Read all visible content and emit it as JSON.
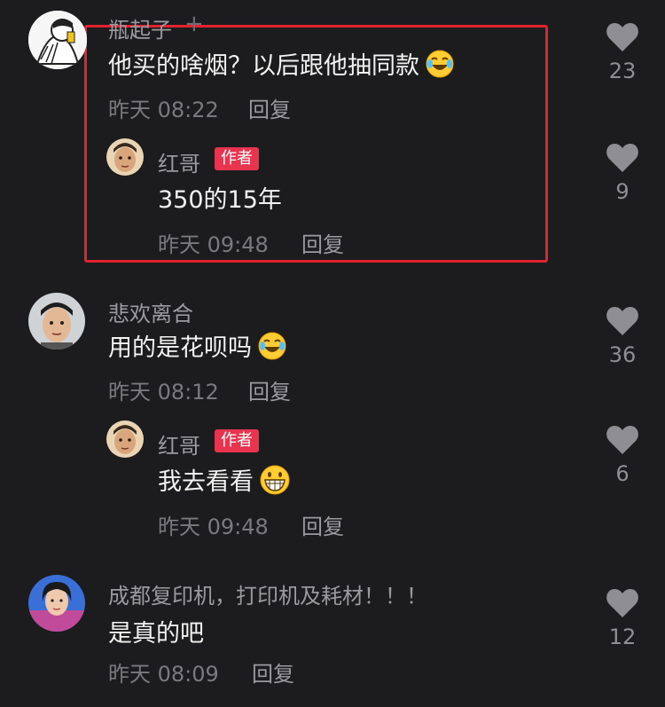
{
  "comments": [
    {
      "user": "瓶起子",
      "text": "他买的啥烟？以后跟他抽同款",
      "emoji": "laughing-crying-emoji",
      "time": "昨天 08:22",
      "reply_label": "回复",
      "likes": "23",
      "reply": {
        "user": "红哥",
        "badge": "作者",
        "text": "350的15年",
        "time": "昨天 09:48",
        "reply_label": "回复",
        "likes": "9"
      }
    },
    {
      "user": "悲欢离合",
      "text": "用的是花呗吗",
      "emoji": "laughing-crying-emoji",
      "time": "昨天 08:12",
      "reply_label": "回复",
      "likes": "36",
      "reply": {
        "user": "红哥",
        "badge": "作者",
        "text": "我去看看",
        "emoji": "grinning-emoji",
        "time": "昨天 09:48",
        "reply_label": "回复",
        "likes": "6"
      }
    },
    {
      "user": "成都复印机，打印机及耗材！！！",
      "text": "是真的吧",
      "time": "昨天 08:09",
      "reply_label": "回复",
      "likes": "12"
    }
  ],
  "colors": {
    "background": "#1c1c1e",
    "highlight": "#e2232f",
    "author_badge": "#e8344e"
  }
}
